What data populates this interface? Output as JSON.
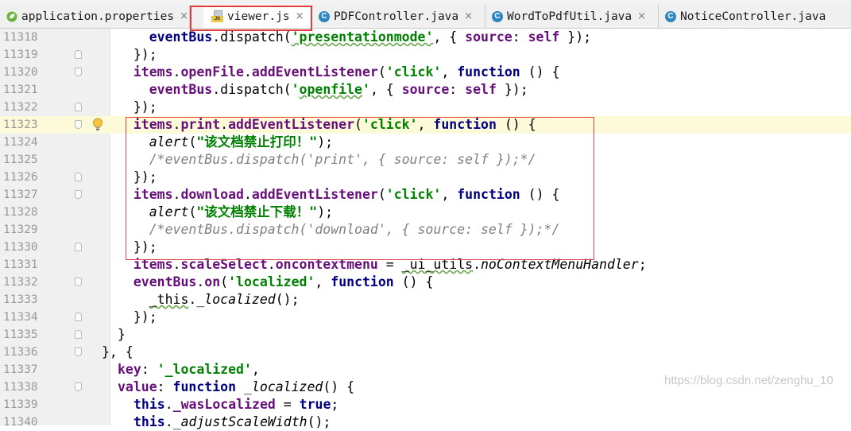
{
  "tabs": [
    {
      "label": "application.properties",
      "icon": "spring-leaf-icon",
      "active": false
    },
    {
      "label": "viewer.js",
      "icon": "js-file-icon",
      "active": true
    },
    {
      "label": "PDFController.java",
      "icon": "java-class-icon",
      "active": false
    },
    {
      "label": "WordToPdfUtil.java",
      "icon": "java-class-icon",
      "active": false
    },
    {
      "label": "NoticeController.java",
      "icon": "java-class-icon",
      "active": false
    }
  ],
  "close_glyph": "×",
  "lines": [
    {
      "n": "11318",
      "t": "      eventBus.dispatch('presentationmode', { source: self });"
    },
    {
      "n": "11319",
      "t": "    });"
    },
    {
      "n": "11320",
      "t": "    items.openFile.addEventListener('click', function () {"
    },
    {
      "n": "11321",
      "t": "      eventBus.dispatch('openfile', { source: self });"
    },
    {
      "n": "11322",
      "t": "    });"
    },
    {
      "n": "11323",
      "t": "    items.print.addEventListener('click', function () {"
    },
    {
      "n": "11324",
      "t": "      alert(\"该文档禁止打印！\");"
    },
    {
      "n": "11325",
      "t": "      /*eventBus.dispatch('print', { source: self });*/"
    },
    {
      "n": "11326",
      "t": "    });"
    },
    {
      "n": "11327",
      "t": "    items.download.addEventListener('click', function () {"
    },
    {
      "n": "11328",
      "t": "      alert(\"该文档禁止下载！\");"
    },
    {
      "n": "11329",
      "t": "      /*eventBus.dispatch('download', { source: self });*/"
    },
    {
      "n": "11330",
      "t": "    });"
    },
    {
      "n": "11331",
      "t": "    items.scaleSelect.oncontextmenu = _ui_utils.noContextMenuHandler;"
    },
    {
      "n": "11332",
      "t": "    eventBus.on('localized', function () {"
    },
    {
      "n": "11333",
      "t": "      _this._localized();"
    },
    {
      "n": "11334",
      "t": "    });"
    },
    {
      "n": "11335",
      "t": "  }"
    },
    {
      "n": "11336",
      "t": "}, {"
    },
    {
      "n": "11337",
      "t": "  key: '_localized',"
    },
    {
      "n": "11338",
      "t": "  value: function _localized() {"
    },
    {
      "n": "11339",
      "t": "    this._wasLocalized = true;"
    },
    {
      "n": "11340",
      "t": "    this._adjustScaleWidth();"
    }
  ],
  "watermark": "https://blog.csdn.net/zenghu_10"
}
